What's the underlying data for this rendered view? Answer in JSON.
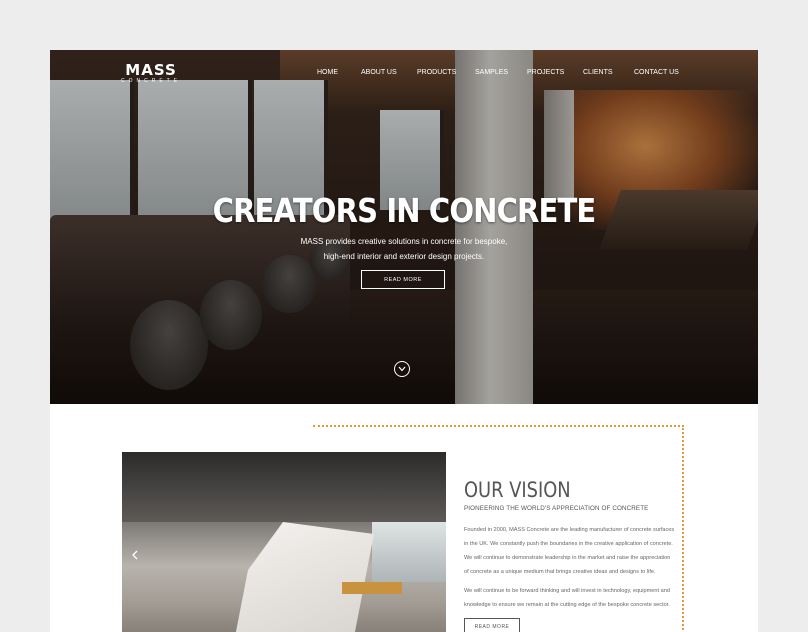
{
  "brand": {
    "line1": "MASS",
    "line2": "CONCRETE"
  },
  "nav": [
    {
      "label": "HOME"
    },
    {
      "label": "ABOUT US"
    },
    {
      "label": "PRODUCTS"
    },
    {
      "label": "SAMPLES"
    },
    {
      "label": "PROJECTS"
    },
    {
      "label": "CLIENTS"
    },
    {
      "label": "CONTACT US"
    }
  ],
  "hero": {
    "title": "CREATORS IN CONCRETE",
    "sub_line1": "MASS provides creative solutions in concrete for bespoke,",
    "sub_line2": "high-end interior and exterior design projects.",
    "button": "READ MORE",
    "scroll_icon": "chevron-down-icon"
  },
  "vision": {
    "title": "OUR VISION",
    "subtitle": "PIONEERING THE WORLD'S APPRECIATION OF CONCRETE",
    "p1_lines": [
      "Founded in 2000, MASS Concrete are the leading manufacturer of concrete surfaces",
      "in the UK. We constantly push the boundaries in the creative application of concrete.",
      "We will continue to demonstrate leadership in the market and raise the appreciation",
      "of concrete as a unique medium that brings creative ideas and designs to life."
    ],
    "p2_lines": [
      "We will continue to be forward thinking and will invest in technology, equipment and",
      "knowledge to ensure we remain at the cutting edge of the bespoke concrete sector."
    ],
    "button": "READ MORE",
    "slider_prev_icon": "chevron-left-icon"
  },
  "colors": {
    "accent_dots": "#e09a3a",
    "text": "#555555"
  }
}
